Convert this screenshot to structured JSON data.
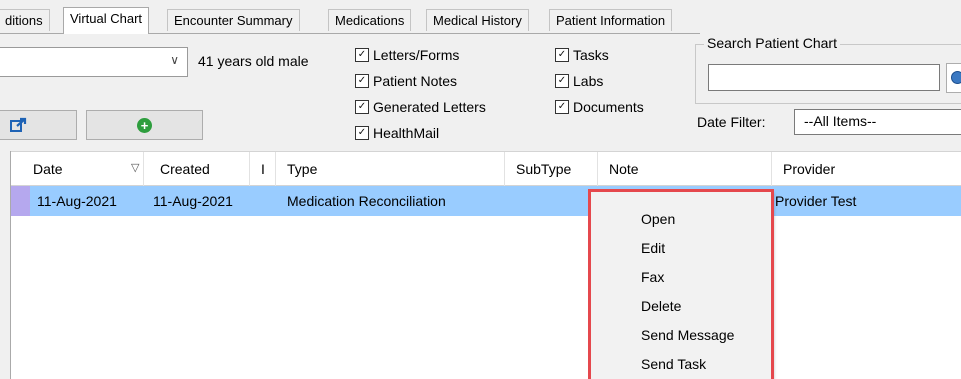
{
  "tabs": [
    {
      "label": "ditions",
      "active": false
    },
    {
      "label": "Virtual Chart",
      "active": true
    },
    {
      "label": "Encounter Summary",
      "active": false
    },
    {
      "label": "Medications",
      "active": false
    },
    {
      "label": "Medical History",
      "active": false
    },
    {
      "label": "Patient Information",
      "active": false
    }
  ],
  "patient": {
    "age_text": "41 years old male",
    "combo_value": ""
  },
  "filters": {
    "letters_forms": {
      "label": "Letters/Forms",
      "checked": true
    },
    "patient_notes": {
      "label": "Patient Notes",
      "checked": true
    },
    "generated_letters": {
      "label": "Generated Letters",
      "checked": true
    },
    "healthmail": {
      "label": "HealthMail",
      "checked": true
    },
    "tasks": {
      "label": "Tasks",
      "checked": true
    },
    "labs": {
      "label": "Labs",
      "checked": true
    },
    "documents": {
      "label": "Documents",
      "checked": true
    }
  },
  "search": {
    "legend": "Search Patient Chart",
    "value": ""
  },
  "date_filter": {
    "label": "Date Filter:",
    "value": "--All Items--"
  },
  "buttons": {
    "export_icon": "export-icon",
    "add_icon": "add-circle-icon"
  },
  "grid": {
    "columns": [
      "Date",
      "Created",
      "I",
      "Type",
      "SubType",
      "Note",
      "Provider"
    ],
    "rows": [
      {
        "date": "11-Aug-2021",
        "created": "11-Aug-2021",
        "i": "",
        "type": "Medication Reconciliation",
        "subtype": "",
        "note": "",
        "provider": "Provider Test",
        "selected": true
      }
    ]
  },
  "context_menu": {
    "items": [
      "Open",
      "Edit",
      "Fax",
      "Delete",
      "Send Message",
      "Send Task"
    ]
  },
  "colors": {
    "selection": "#99ccff",
    "row_indicator": "#b5a8ee",
    "highlight_border": "#e5484d",
    "add_green": "#2e9e3e"
  }
}
